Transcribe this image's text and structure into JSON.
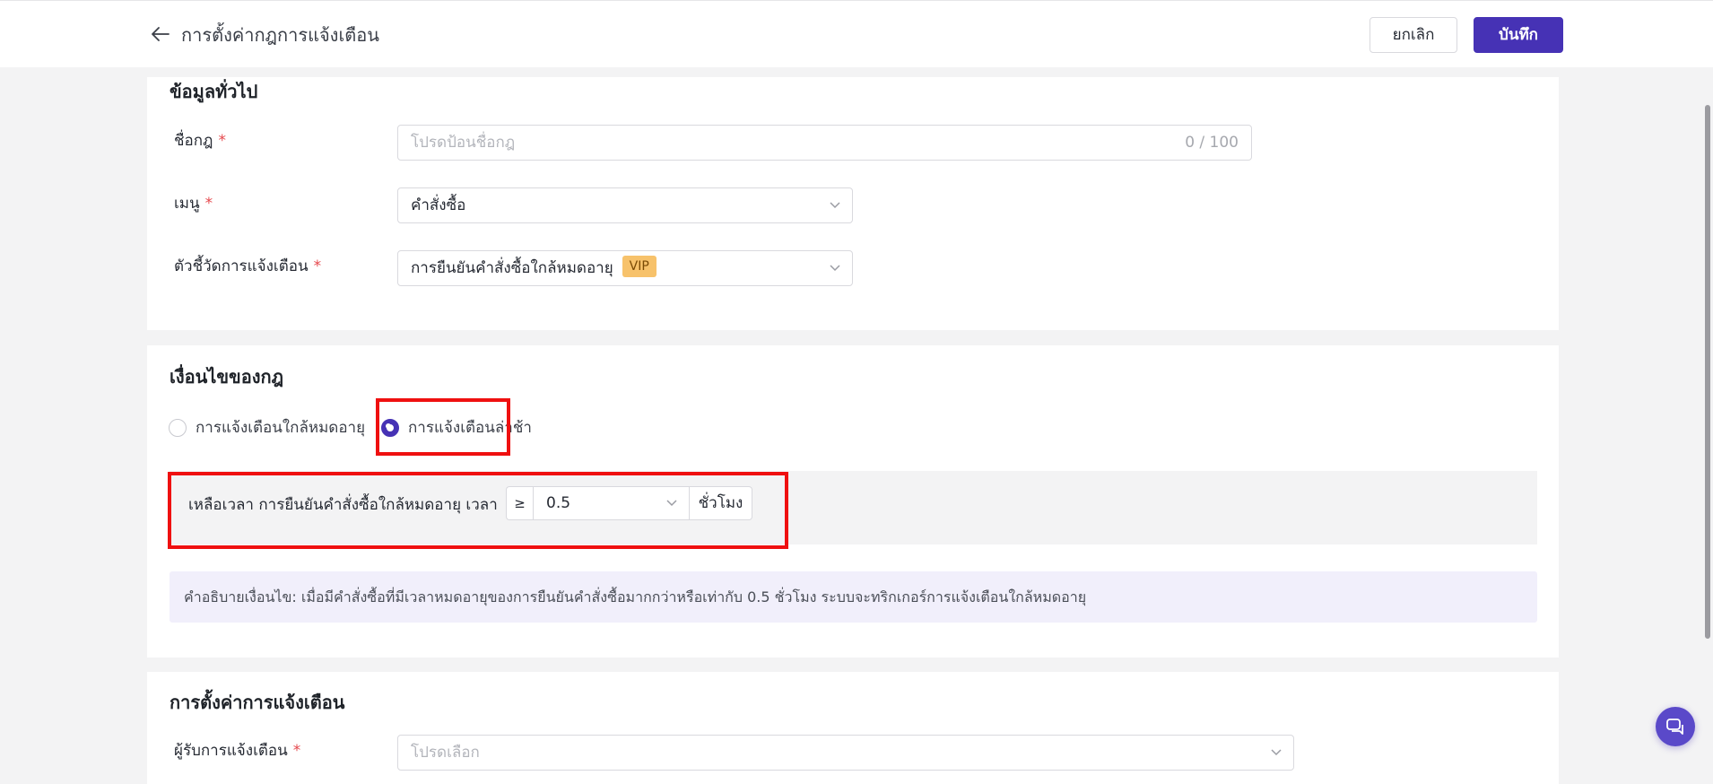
{
  "header": {
    "title": "การตั้งค่ากฎการแจ้งเตือน",
    "cancel_label": "ยกเลิก",
    "save_label": "บันทึก"
  },
  "general": {
    "section_title": "ข้อมูลทั่วไป",
    "name_label": "ชื่อกฎ",
    "name_placeholder": "โปรดป้อนชื่อกฎ",
    "name_counter": "0 / 100",
    "menu_label": "เมนู",
    "menu_value": "คำสั่งซื้อ",
    "indicator_label": "ตัวชี้วัดการแจ้งเตือน",
    "indicator_value": "การยืนยันคำสั่งซื้อใกล้หมดอายุ",
    "indicator_badge": "VIP",
    "required_mark": "*"
  },
  "conditions": {
    "section_title": "เงื่อนไขของกฎ",
    "options": [
      {
        "label": "การแจ้งเตือนใกล้หมดอายุ",
        "checked": false
      },
      {
        "label": "การแจ้งเตือนล่าช้า",
        "checked": true
      }
    ],
    "condition_text": "เหลือเวลา การยืนยันคำสั่งซื้อใกล้หมดอายุ เวลา",
    "operator": "≥",
    "value": "0.5",
    "unit": "ชั่วโมง",
    "description": "คำอธิบายเงื่อนไข: เมื่อมีคำสั่งซื้อที่มีเวลาหมดอายุของการยืนยันคำสั่งซื้อมากกว่าหรือเท่ากับ 0.5 ชั่วโมง ระบบจะทริกเกอร์การแจ้งเตือนใกล้หมดอายุ"
  },
  "notification": {
    "section_title": "การตั้งค่าการแจ้งเตือน",
    "recipient_label": "ผู้รับการแจ้งเตือน",
    "recipient_placeholder": "โปรดเลือก"
  },
  "colors": {
    "primary": "#4632b5",
    "highlight": "#ef1010",
    "vip_badge": "#f7c26b",
    "required": "#e5484d"
  },
  "icons": [
    "arrow-left-icon",
    "chevron-down-icon",
    "chat-icon"
  ]
}
